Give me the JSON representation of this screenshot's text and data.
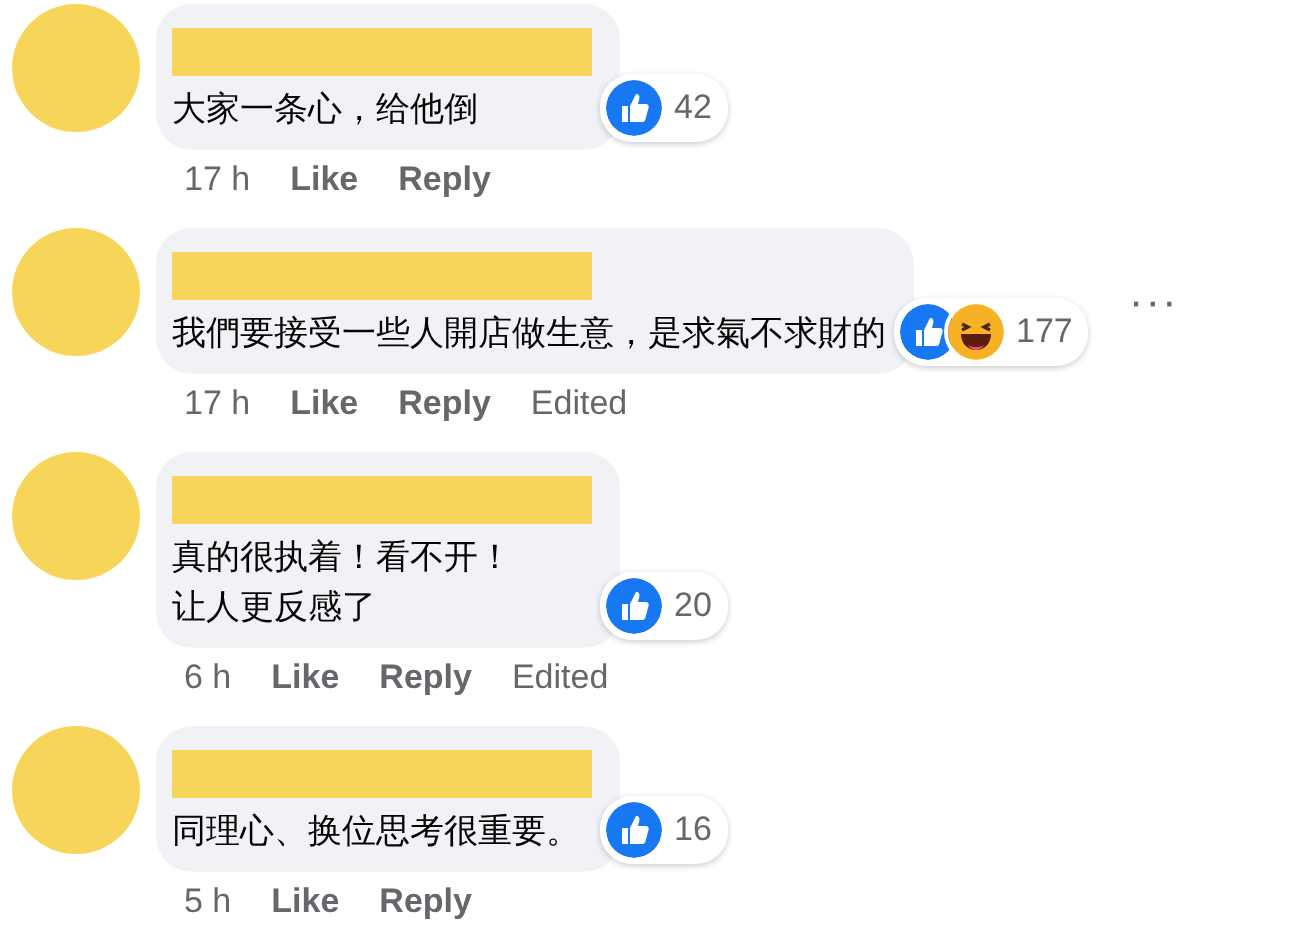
{
  "comments": [
    {
      "lines": [
        "大家一条心，给他倒"
      ],
      "reactions": [
        {
          "kind": "like"
        }
      ],
      "count": "42",
      "time": "17 h",
      "actions": [
        "Like",
        "Reply"
      ]
    },
    {
      "lines": [
        "我們要接受一些人開店做生意，是求氣不求財的"
      ],
      "reactions": [
        {
          "kind": "like"
        },
        {
          "kind": "haha"
        }
      ],
      "count": "177",
      "time": "17 h",
      "actions": [
        "Like",
        "Reply"
      ],
      "edited": "Edited",
      "more_icon": "···"
    },
    {
      "lines": [
        "真的很执着！看不开！",
        "让人更反感了"
      ],
      "reactions": [
        {
          "kind": "like"
        }
      ],
      "count": "20",
      "time": "6 h",
      "actions": [
        "Like",
        "Reply"
      ],
      "edited": "Edited"
    },
    {
      "lines": [
        "同理心、换位思考很重要。"
      ],
      "reactions": [
        {
          "kind": "like"
        }
      ],
      "count": "16",
      "time": "5 h",
      "actions": [
        "Like",
        "Reply"
      ]
    }
  ]
}
